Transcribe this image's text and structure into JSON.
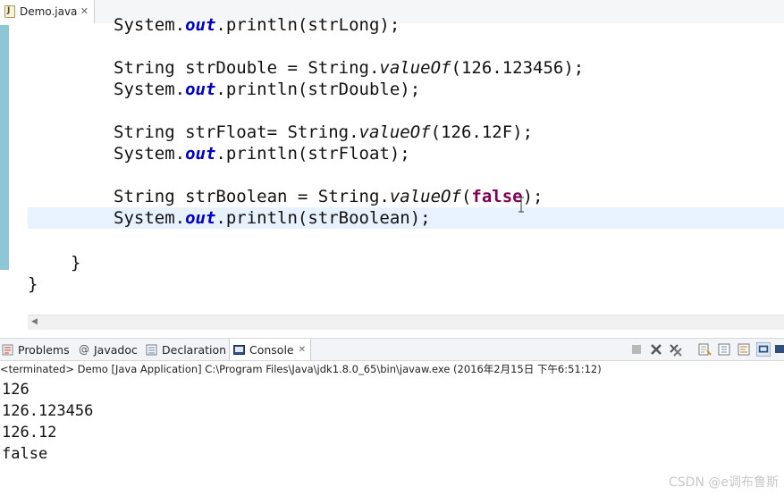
{
  "editor_tab": {
    "label": "Demo.java",
    "close": "✕"
  },
  "code": {
    "l0": {
      "a": "System.",
      "b": "out",
      "c": ".println(strLong);"
    },
    "l1": {
      "a": "String strDouble = String.",
      "b": "valueOf",
      "c": "(126.123456);"
    },
    "l2": {
      "a": "System.",
      "b": "out",
      "c": ".println(strDouble);"
    },
    "l3": {
      "a": "String strFloat= String.",
      "b": "valueOf",
      "c": "(126.12F);"
    },
    "l4": {
      "a": "System.",
      "b": "out",
      "c": ".println(strFloat);"
    },
    "l5": {
      "a": "String strBoolean = String.",
      "b": "valueOf",
      "c": "(",
      "d": "false",
      "e": ");"
    },
    "l6": {
      "a": "System.",
      "b": "out",
      "c": ".println(strBoolean);"
    },
    "l7": "}",
    "l8": "}"
  },
  "panel": {
    "tabs": {
      "problems": "Problems",
      "javadoc": "Javadoc",
      "declaration": "Declaration",
      "console": "Console",
      "console_close": "✕"
    }
  },
  "console": {
    "header": "<terminated> Demo [Java Application] C:\\Program Files\\Java\\jdk1.8.0_65\\bin\\javaw.exe (2016年2月15日 下午6:51:12)",
    "output": [
      "126",
      "126.123456",
      "126.12",
      "false"
    ]
  },
  "watermark": "CSDN @e调布鲁斯",
  "colors": {
    "keyword": "#7f0055",
    "field": "#0000c0",
    "current_line": "#e8f2fe",
    "change_bar": "#8ec6d6"
  }
}
